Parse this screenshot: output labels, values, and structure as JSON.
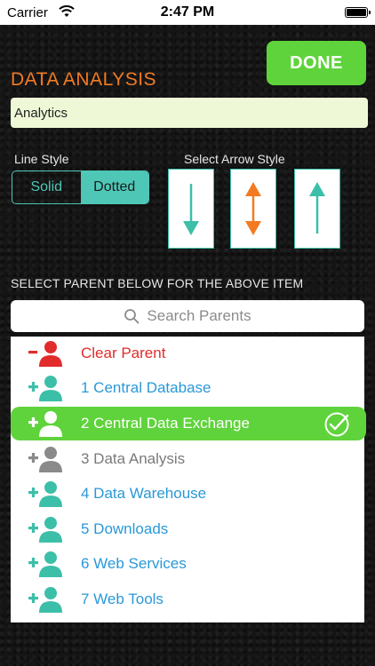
{
  "status_bar": {
    "carrier": "Carrier",
    "time": "2:47 PM"
  },
  "header": {
    "done_label": "DONE",
    "title": "DATA ANALYSIS",
    "name_value": "Analytics"
  },
  "line_style": {
    "label": "Line Style",
    "options": [
      "Solid",
      "Dotted"
    ],
    "selected": "Dotted"
  },
  "arrow_style": {
    "label": "Select Arrow Style",
    "options": [
      "down-arrow-icon",
      "bidirectional-arrow-icon",
      "up-arrow-icon"
    ]
  },
  "parents": {
    "label": "SELECT PARENT BELOW FOR THE ABOVE ITEM",
    "search_placeholder": "Search Parents",
    "items": [
      {
        "label": "Clear Parent",
        "icon": "remove-user-icon",
        "color": "#e22b2b"
      },
      {
        "label": "1 Central Database",
        "icon": "add-user-icon",
        "color": "#2a98d8"
      },
      {
        "label": "2 Central Data Exchange",
        "icon": "add-user-icon",
        "color": "#ffffff",
        "selected": true
      },
      {
        "label": "3 Data Analysis",
        "icon": "add-user-icon",
        "color": "#8a8a8a"
      },
      {
        "label": "4 Data Warehouse",
        "icon": "add-user-icon",
        "color": "#2a98d8"
      },
      {
        "label": "5 Downloads",
        "icon": "add-user-icon",
        "color": "#2a98d8"
      },
      {
        "label": "6 Web Services",
        "icon": "add-user-icon",
        "color": "#2a98d8"
      },
      {
        "label": "7 Web Tools",
        "icon": "add-user-icon",
        "color": "#2a98d8"
      }
    ]
  },
  "colors": {
    "accent_green": "#5fd33b",
    "teal": "#3cbfa9",
    "orange": "#f27a22",
    "blue": "#2a98d8",
    "red": "#e22b2b"
  }
}
